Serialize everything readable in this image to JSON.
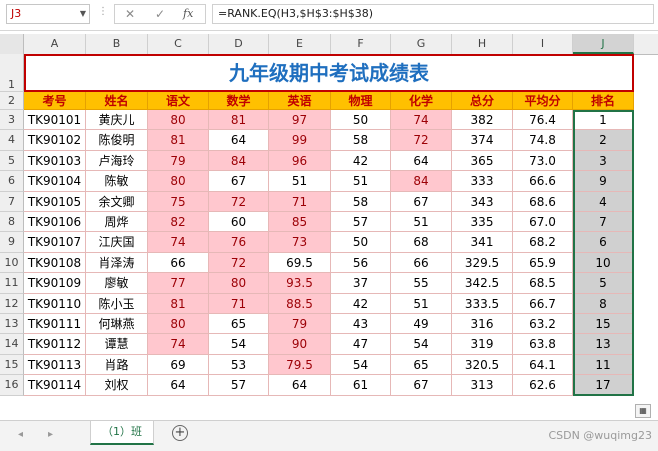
{
  "formula_bar": {
    "name_box": "J3",
    "cancel_glyph": "✕",
    "enter_glyph": "✓",
    "fx_label": "fx",
    "formula": "=RANK.EQ(H3,$H$3:$H$38)"
  },
  "columns": [
    "A",
    "B",
    "C",
    "D",
    "E",
    "F",
    "G",
    "H",
    "I",
    "J"
  ],
  "selected_column": "J",
  "row_numbers": [
    "1",
    "2",
    "3",
    "4",
    "5",
    "6",
    "7",
    "8",
    "9",
    "10",
    "11",
    "12",
    "13",
    "14",
    "15",
    "16"
  ],
  "title": "九年级期中考试成绩表",
  "headers": [
    "考号",
    "姓名",
    "语文",
    "数学",
    "英语",
    "物理",
    "化学",
    "总分",
    "平均分",
    "排名"
  ],
  "rows": [
    [
      "TK90101",
      "黄庆儿",
      "80",
      "81",
      "97",
      "50",
      "74",
      "382",
      "76.4",
      "1"
    ],
    [
      "TK90102",
      "陈俊明",
      "81",
      "64",
      "99",
      "58",
      "72",
      "374",
      "74.8",
      "2"
    ],
    [
      "TK90103",
      "卢海玲",
      "79",
      "84",
      "96",
      "42",
      "64",
      "365",
      "73.0",
      "3"
    ],
    [
      "TK90104",
      "陈敏",
      "80",
      "67",
      "51",
      "51",
      "84",
      "333",
      "66.6",
      "9"
    ],
    [
      "TK90105",
      "余文卿",
      "75",
      "72",
      "71",
      "58",
      "67",
      "343",
      "68.6",
      "4"
    ],
    [
      "TK90106",
      "周烨",
      "82",
      "60",
      "85",
      "57",
      "51",
      "335",
      "67.0",
      "7"
    ],
    [
      "TK90107",
      "江庆国",
      "74",
      "76",
      "73",
      "50",
      "68",
      "341",
      "68.2",
      "6"
    ],
    [
      "TK90108",
      "肖泽涛",
      "66",
      "72",
      "69.5",
      "56",
      "66",
      "329.5",
      "65.9",
      "10"
    ],
    [
      "TK90109",
      "廖敏",
      "77",
      "80",
      "93.5",
      "37",
      "55",
      "342.5",
      "68.5",
      "5"
    ],
    [
      "TK90110",
      "陈小玉",
      "81",
      "71",
      "88.5",
      "42",
      "51",
      "333.5",
      "66.7",
      "8"
    ],
    [
      "TK90111",
      "何琳燕",
      "80",
      "65",
      "79",
      "43",
      "49",
      "316",
      "63.2",
      "15"
    ],
    [
      "TK90112",
      "谭慧",
      "74",
      "54",
      "90",
      "47",
      "54",
      "319",
      "63.8",
      "13"
    ],
    [
      "TK90113",
      "肖路",
      "69",
      "53",
      "79.5",
      "54",
      "65",
      "320.5",
      "64.1",
      "11"
    ],
    [
      "TK90114",
      "刘权",
      "64",
      "57",
      "64",
      "61",
      "67",
      "313",
      "62.6",
      "17"
    ]
  ],
  "sheet_tabs": {
    "active": "（1）班",
    "add_glyph": "+",
    "nav_left": "◂",
    "nav_right": "▸"
  },
  "watermark": "CSDN @wuqimg23",
  "colors": {
    "header_fill": "#ffc000",
    "header_text": "#c00000",
    "highlight_fill": "#ffc7ce",
    "highlight_text": "#9c0006",
    "title_text": "#1f6fbf",
    "rank_fill": "#d0d0d0",
    "accent": "#217346"
  }
}
